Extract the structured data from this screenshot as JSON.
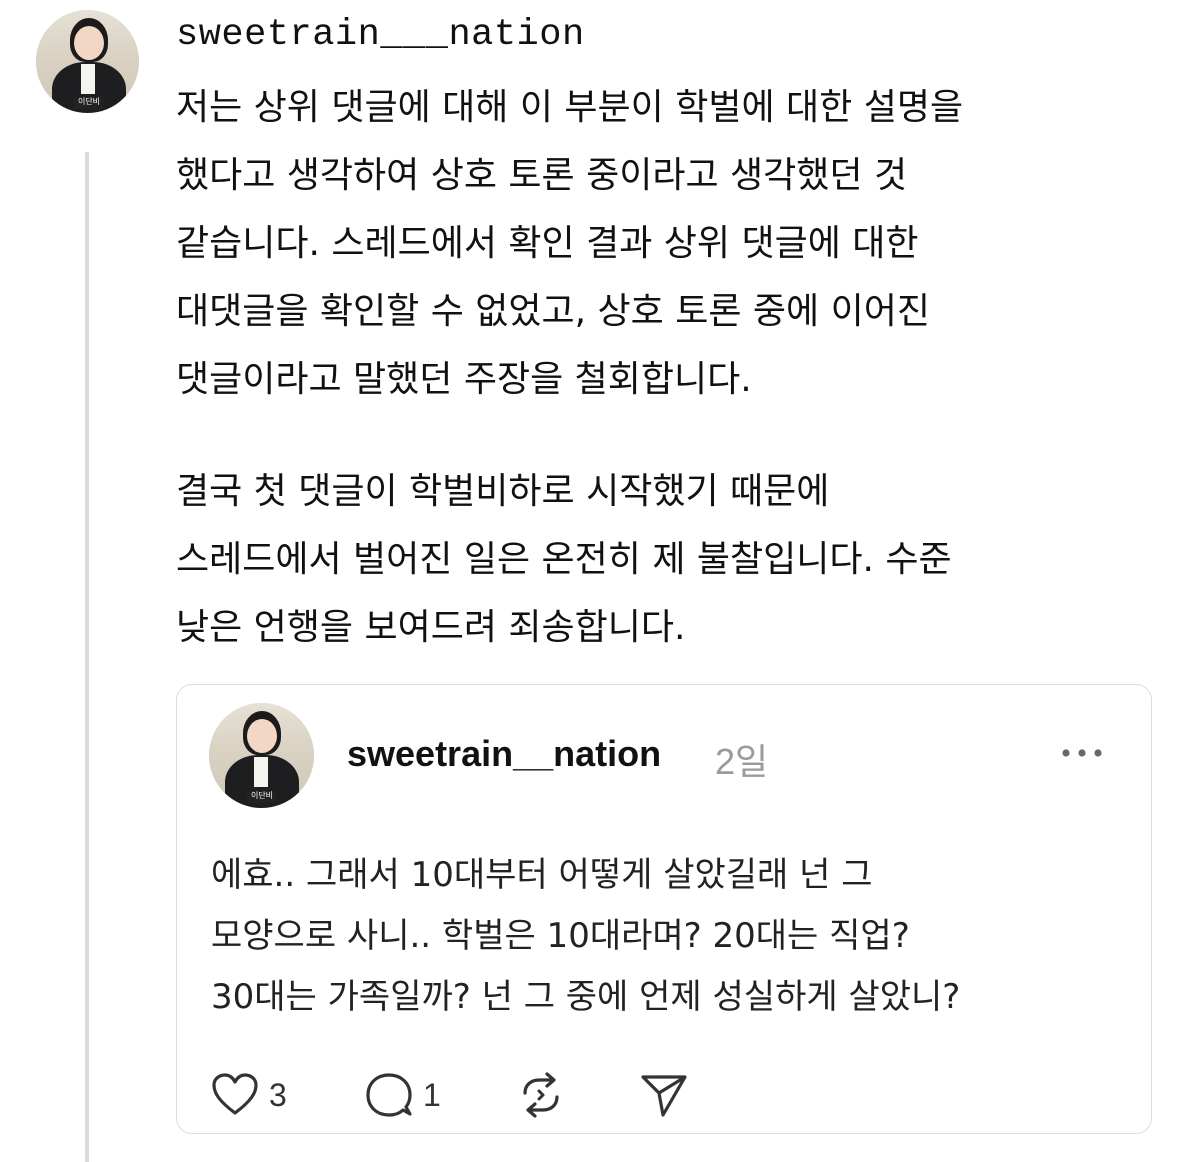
{
  "post": {
    "username": "sweetrain___nation",
    "avatar_label": "이단비",
    "paragraphs": [
      [
        "저는 상위 댓글에 대해 이 부분이 학벌에 대한 설명을",
        "했다고 생각하여 상호 토론 중이라고 생각했던 것",
        "같습니다. 스레드에서 확인 결과 상위 댓글에 대한",
        "대댓글을 확인할 수 없었고,  상호 토론 중에 이어진",
        "댓글이라고 말했던 주장을 철회합니다."
      ],
      [
        "결국 첫 댓글이 학벌비하로 시작했기 때문에",
        "스레드에서 벌어진 일은 온전히 제 불찰입니다. 수준",
        "낮은 언행을 보여드려 죄송합니다."
      ]
    ]
  },
  "quoted_post": {
    "username": "sweetrain__nation",
    "time": "2일",
    "avatar_label": "이단비",
    "text_lines": [
      "에효.. 그래서 10대부터 어떻게 살았길래 넌 그",
      "모양으로 사니.. 학벌은 10대라며? 20대는 직업?",
      "30대는 가족일까? 넌 그 중에 언제 성실하게 살았니?"
    ],
    "likes": "3",
    "replies": "1",
    "icons": [
      "more-icon",
      "heart-icon",
      "comment-icon",
      "repost-icon",
      "share-icon"
    ]
  }
}
